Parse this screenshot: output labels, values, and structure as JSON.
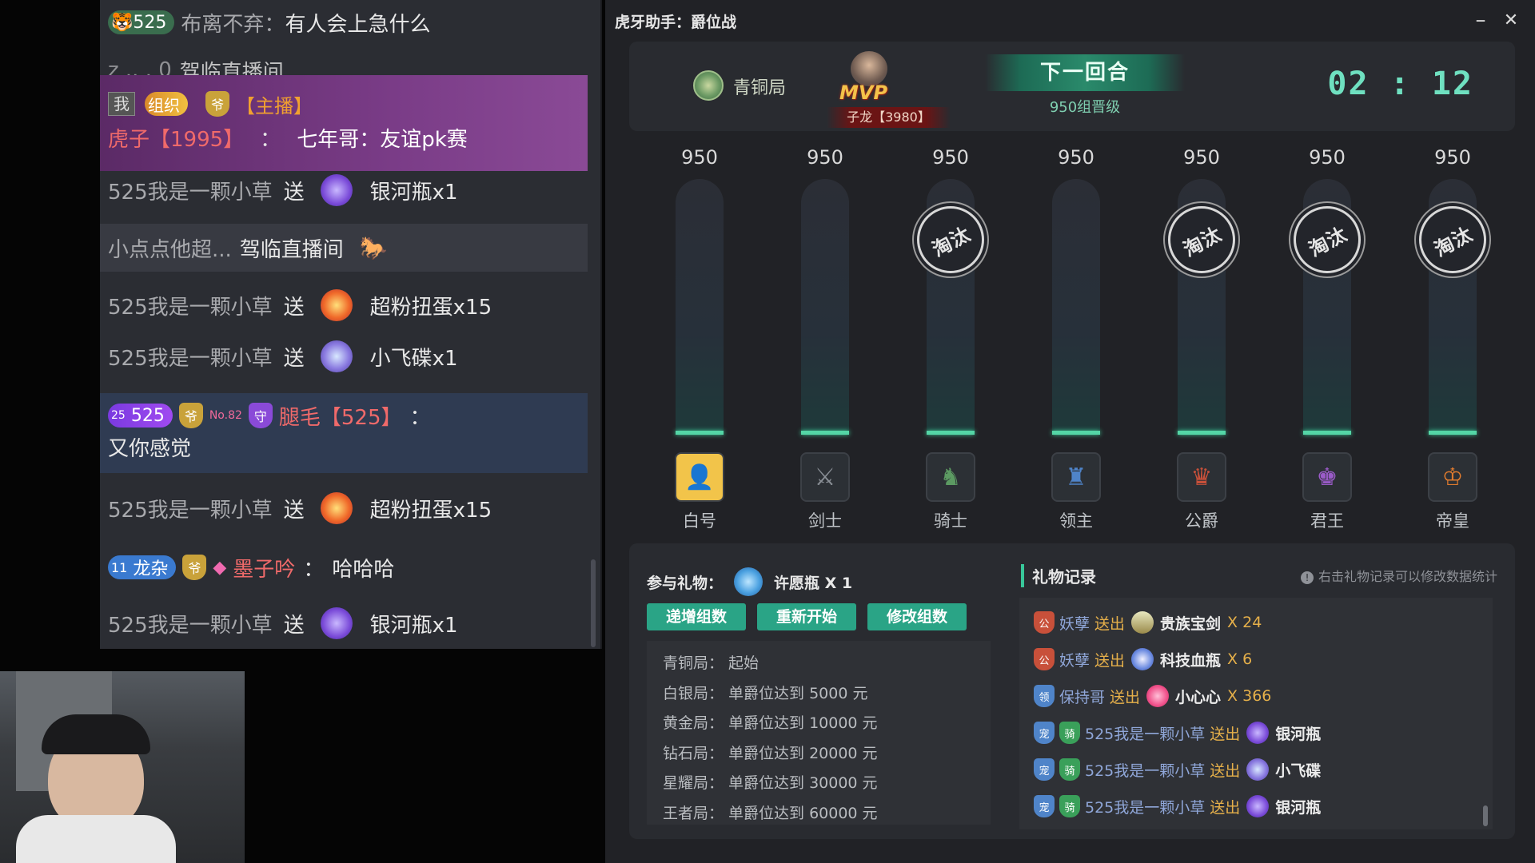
{
  "chat": {
    "messages": [
      {
        "badge_level": "525",
        "user": "布离不弃",
        "sep": "：",
        "text": "有人会上急什么"
      },
      {
        "user": "z  .. .  0",
        "text": "驾临直播间"
      },
      {
        "badge_me": "我",
        "badge_org": "组织",
        "badge_role": "【主播】",
        "user": "虎子【1995】",
        "sep": "：",
        "text": "七年哥：友谊pk赛"
      },
      {
        "user": "525我是一颗小草",
        "action": "送",
        "gift": "银河瓶x1"
      },
      {
        "user": "小点点他超...",
        "text": "驾临直播间"
      },
      {
        "user": "525我是一颗小草",
        "action": "送",
        "gift": "超粉扭蛋x15"
      },
      {
        "user": "525我是一颗小草",
        "action": "送",
        "gift": "小飞碟x1"
      },
      {
        "badge_level": "525",
        "badge_sub": "25",
        "badge_no": "No.82",
        "user": "腿毛【525】",
        "sep": "：",
        "text": "又你感觉"
      },
      {
        "user": "525我是一颗小草",
        "action": "送",
        "gift": "超粉扭蛋x15"
      },
      {
        "badge_level": "11",
        "badge_name": "龙杂",
        "user": "墨子吟",
        "sep": "：",
        "text": "哈哈哈"
      },
      {
        "user": "525我是一颗小草",
        "action": "送",
        "gift": "银河瓶x1"
      }
    ]
  },
  "window": {
    "title": "虎牙助手：爵位战",
    "minimize_icon": "–",
    "close_icon": "✕"
  },
  "top": {
    "round_name": "青铜局",
    "mvp_label": "MVP",
    "mvp_user": "子龙【3980】",
    "next_round": "下一回合",
    "next_sub": "950组晋级",
    "timer": "02 : 12"
  },
  "columns": [
    {
      "value": "950",
      "rank": "白号",
      "eliminated": false,
      "icon": "user-icon",
      "icon_glyph": "👤",
      "color": "#f2c44a"
    },
    {
      "value": "950",
      "rank": "剑士",
      "eliminated": false,
      "icon": "sword-icon",
      "icon_glyph": "⚔",
      "color": "#8a8f96"
    },
    {
      "value": "950",
      "rank": "骑士",
      "eliminated": true,
      "icon": "knight-icon",
      "icon_glyph": "♞",
      "color": "#5c9a62"
    },
    {
      "value": "950",
      "rank": "领主",
      "eliminated": false,
      "icon": "lord-icon",
      "icon_glyph": "♜",
      "color": "#4f84c9"
    },
    {
      "value": "950",
      "rank": "公爵",
      "eliminated": true,
      "icon": "duke-icon",
      "icon_glyph": "♛",
      "color": "#c8503a"
    },
    {
      "value": "950",
      "rank": "君王",
      "eliminated": true,
      "icon": "monarch-icon",
      "icon_glyph": "♚",
      "color": "#9a5bc8"
    },
    {
      "value": "950",
      "rank": "帝皇",
      "eliminated": true,
      "icon": "emperor-icon",
      "icon_glyph": "♔",
      "color": "#e07b2e"
    }
  ],
  "eliminated_label": "淘汰",
  "bottom": {
    "gift_label": "参与礼物：",
    "gift_name": "许愿瓶 X 1",
    "buttons": [
      "递增组数",
      "重新开始",
      "修改组数"
    ],
    "rules": [
      "青铜局： 起始",
      "白银局： 单爵位达到 5000 元",
      "黄金局： 单爵位达到 10000 元",
      "钻石局： 单爵位达到 20000 元",
      "星耀局： 单爵位达到 30000 元",
      "王者局： 单爵位达到 60000 元"
    ],
    "record_title": "礼物记录",
    "record_tip": "右击礼物记录可以修改数据统计",
    "records": [
      {
        "user": "妖孽",
        "action": "送出",
        "gift": "贵族宝剑",
        "count": "X 24"
      },
      {
        "user": "妖孽",
        "action": "送出",
        "gift": "科技血瓶",
        "count": "X 6"
      },
      {
        "user": "保持哥",
        "action": "送出",
        "gift": "小心心",
        "count": "X 366"
      },
      {
        "user": "525我是一颗小草",
        "action": "送出",
        "gift": "银河瓶",
        "count": ""
      },
      {
        "user": "525我是一颗小草",
        "action": "送出",
        "gift": "小飞碟",
        "count": ""
      },
      {
        "user": "525我是一颗小草",
        "action": "送出",
        "gift": "银河瓶",
        "count": ""
      }
    ]
  }
}
